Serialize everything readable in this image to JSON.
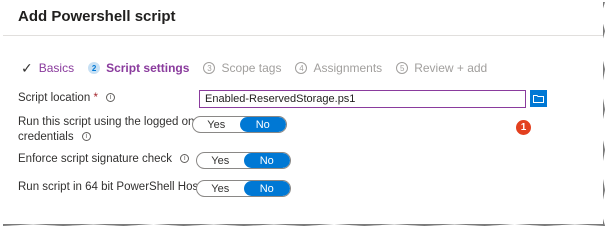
{
  "dialog": {
    "title": "Add Powershell script"
  },
  "steps": [
    {
      "number": "",
      "label": "Basics",
      "state": "done"
    },
    {
      "number": "2",
      "label": "Script settings",
      "state": "active"
    },
    {
      "number": "3",
      "label": "Scope tags",
      "state": "pending"
    },
    {
      "number": "4",
      "label": "Assignments",
      "state": "pending"
    },
    {
      "number": "5",
      "label": "Review + add",
      "state": "pending"
    }
  ],
  "form": {
    "script_location": {
      "label": "Script location",
      "required_mark": "*",
      "value": "Enabled-ReservedStorage.ps1",
      "callout_number": "1"
    },
    "run_as_logged_on": {
      "label_line1": "Run this script using the logged on",
      "label_line2": "credentials",
      "yes": "Yes",
      "no": "No",
      "selected": "No"
    },
    "enforce_signature": {
      "label": "Enforce script signature check",
      "yes": "Yes",
      "no": "No",
      "selected": "No"
    },
    "run_64bit": {
      "label": "Run script in 64 bit PowerShell Host",
      "yes": "Yes",
      "no": "No",
      "selected": "No"
    }
  },
  "icons": {
    "check": "checkmark-icon",
    "info": "info-icon",
    "browse": "folder-icon"
  },
  "colors": {
    "accent": "#0078d4",
    "active_step": "#8a3b9d",
    "callout": "#e3401f"
  }
}
